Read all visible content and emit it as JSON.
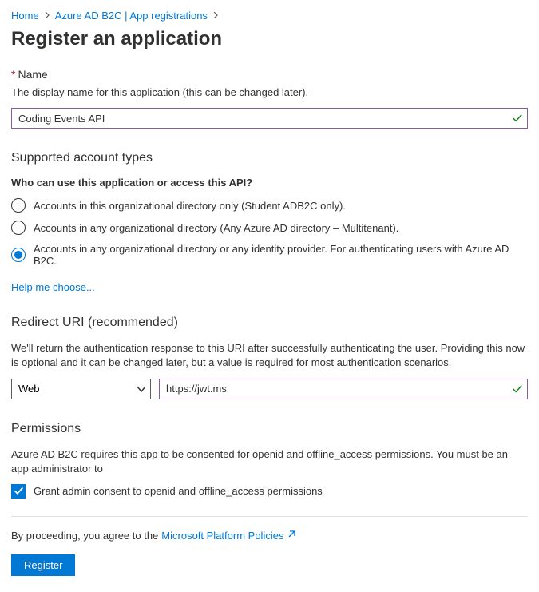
{
  "breadcrumb": {
    "home": "Home",
    "tenant": "Azure AD B2C | App registrations"
  },
  "title": "Register an application",
  "name_section": {
    "label": "Name",
    "helper": "The display name for this application (this can be changed later).",
    "value": "Coding Events API"
  },
  "account_types": {
    "heading": "Supported account types",
    "question": "Who can use this application or access this API?",
    "options": [
      "Accounts in this organizational directory only (Student ADB2C only).",
      "Accounts in any organizational directory (Any Azure AD directory – Multitenant).",
      "Accounts in any organizational directory or any identity provider. For authenticating users with Azure AD B2C."
    ],
    "help_link": "Help me choose..."
  },
  "redirect": {
    "heading": "Redirect URI (recommended)",
    "helper": "We'll return the authentication response to this URI after successfully authenticating the user. Providing this now is optional and it can be changed later, but a value is required for most authentication scenarios.",
    "platform": "Web",
    "uri": "https://jwt.ms"
  },
  "permissions": {
    "heading": "Permissions",
    "helper": "Azure AD B2C requires this app to be consented for openid and offline_access permissions. You must be an app administrator to",
    "checkbox_label": "Grant admin consent to openid and offline_access permissions"
  },
  "footer": {
    "agree_prefix": "By proceeding, you agree to the ",
    "policies_link": "Microsoft Platform Policies",
    "register": "Register"
  }
}
